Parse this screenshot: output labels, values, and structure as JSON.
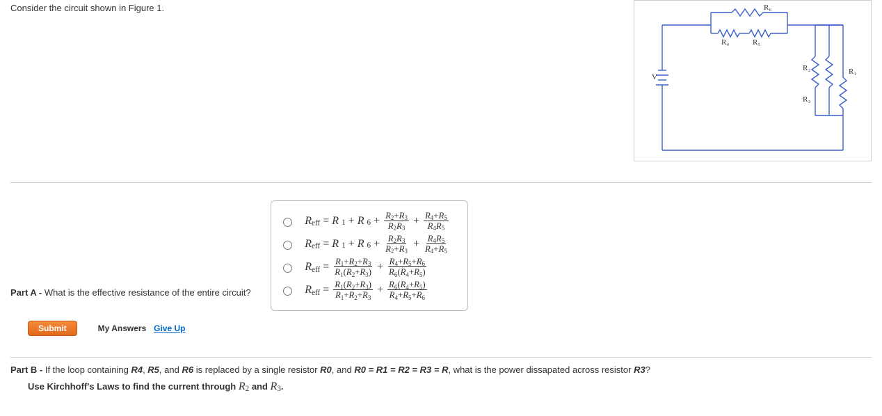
{
  "prompt": "Consider the circuit shown in Figure 1.",
  "partA": {
    "label": "Part A - ",
    "question": "What is the effective resistance of the entire circuit?"
  },
  "actions": {
    "submit": "Submit",
    "myAnswers": "My Answers",
    "giveUp": "Give Up"
  },
  "partB": {
    "label": "Part B - ",
    "question_prefix": "If the loop containing ",
    "question_mid1": " is replaced by a single resistor ",
    "question_mid2": ", and ",
    "question_eq": "R0 = R1 = R2 = R3 = R",
    "question_mid3": ", what is the power dissapated across resistor ",
    "question_end": "?",
    "r4": "R4",
    "r5": "R5",
    "r6": "R6",
    "r0": "R0",
    "r3": "R3",
    "and1": ", ",
    "and2": ", and ",
    "note_prefix": "Use Kirchhoff's Laws to find the current through  ",
    "note_and": "  and  ",
    "note_end": "."
  },
  "figure_labels": {
    "V": "V",
    "R1": "R₁",
    "R2": "R₂",
    "R3": "R₃",
    "R4": "R₄",
    "R5": "R₅",
    "R6": "R₆"
  }
}
